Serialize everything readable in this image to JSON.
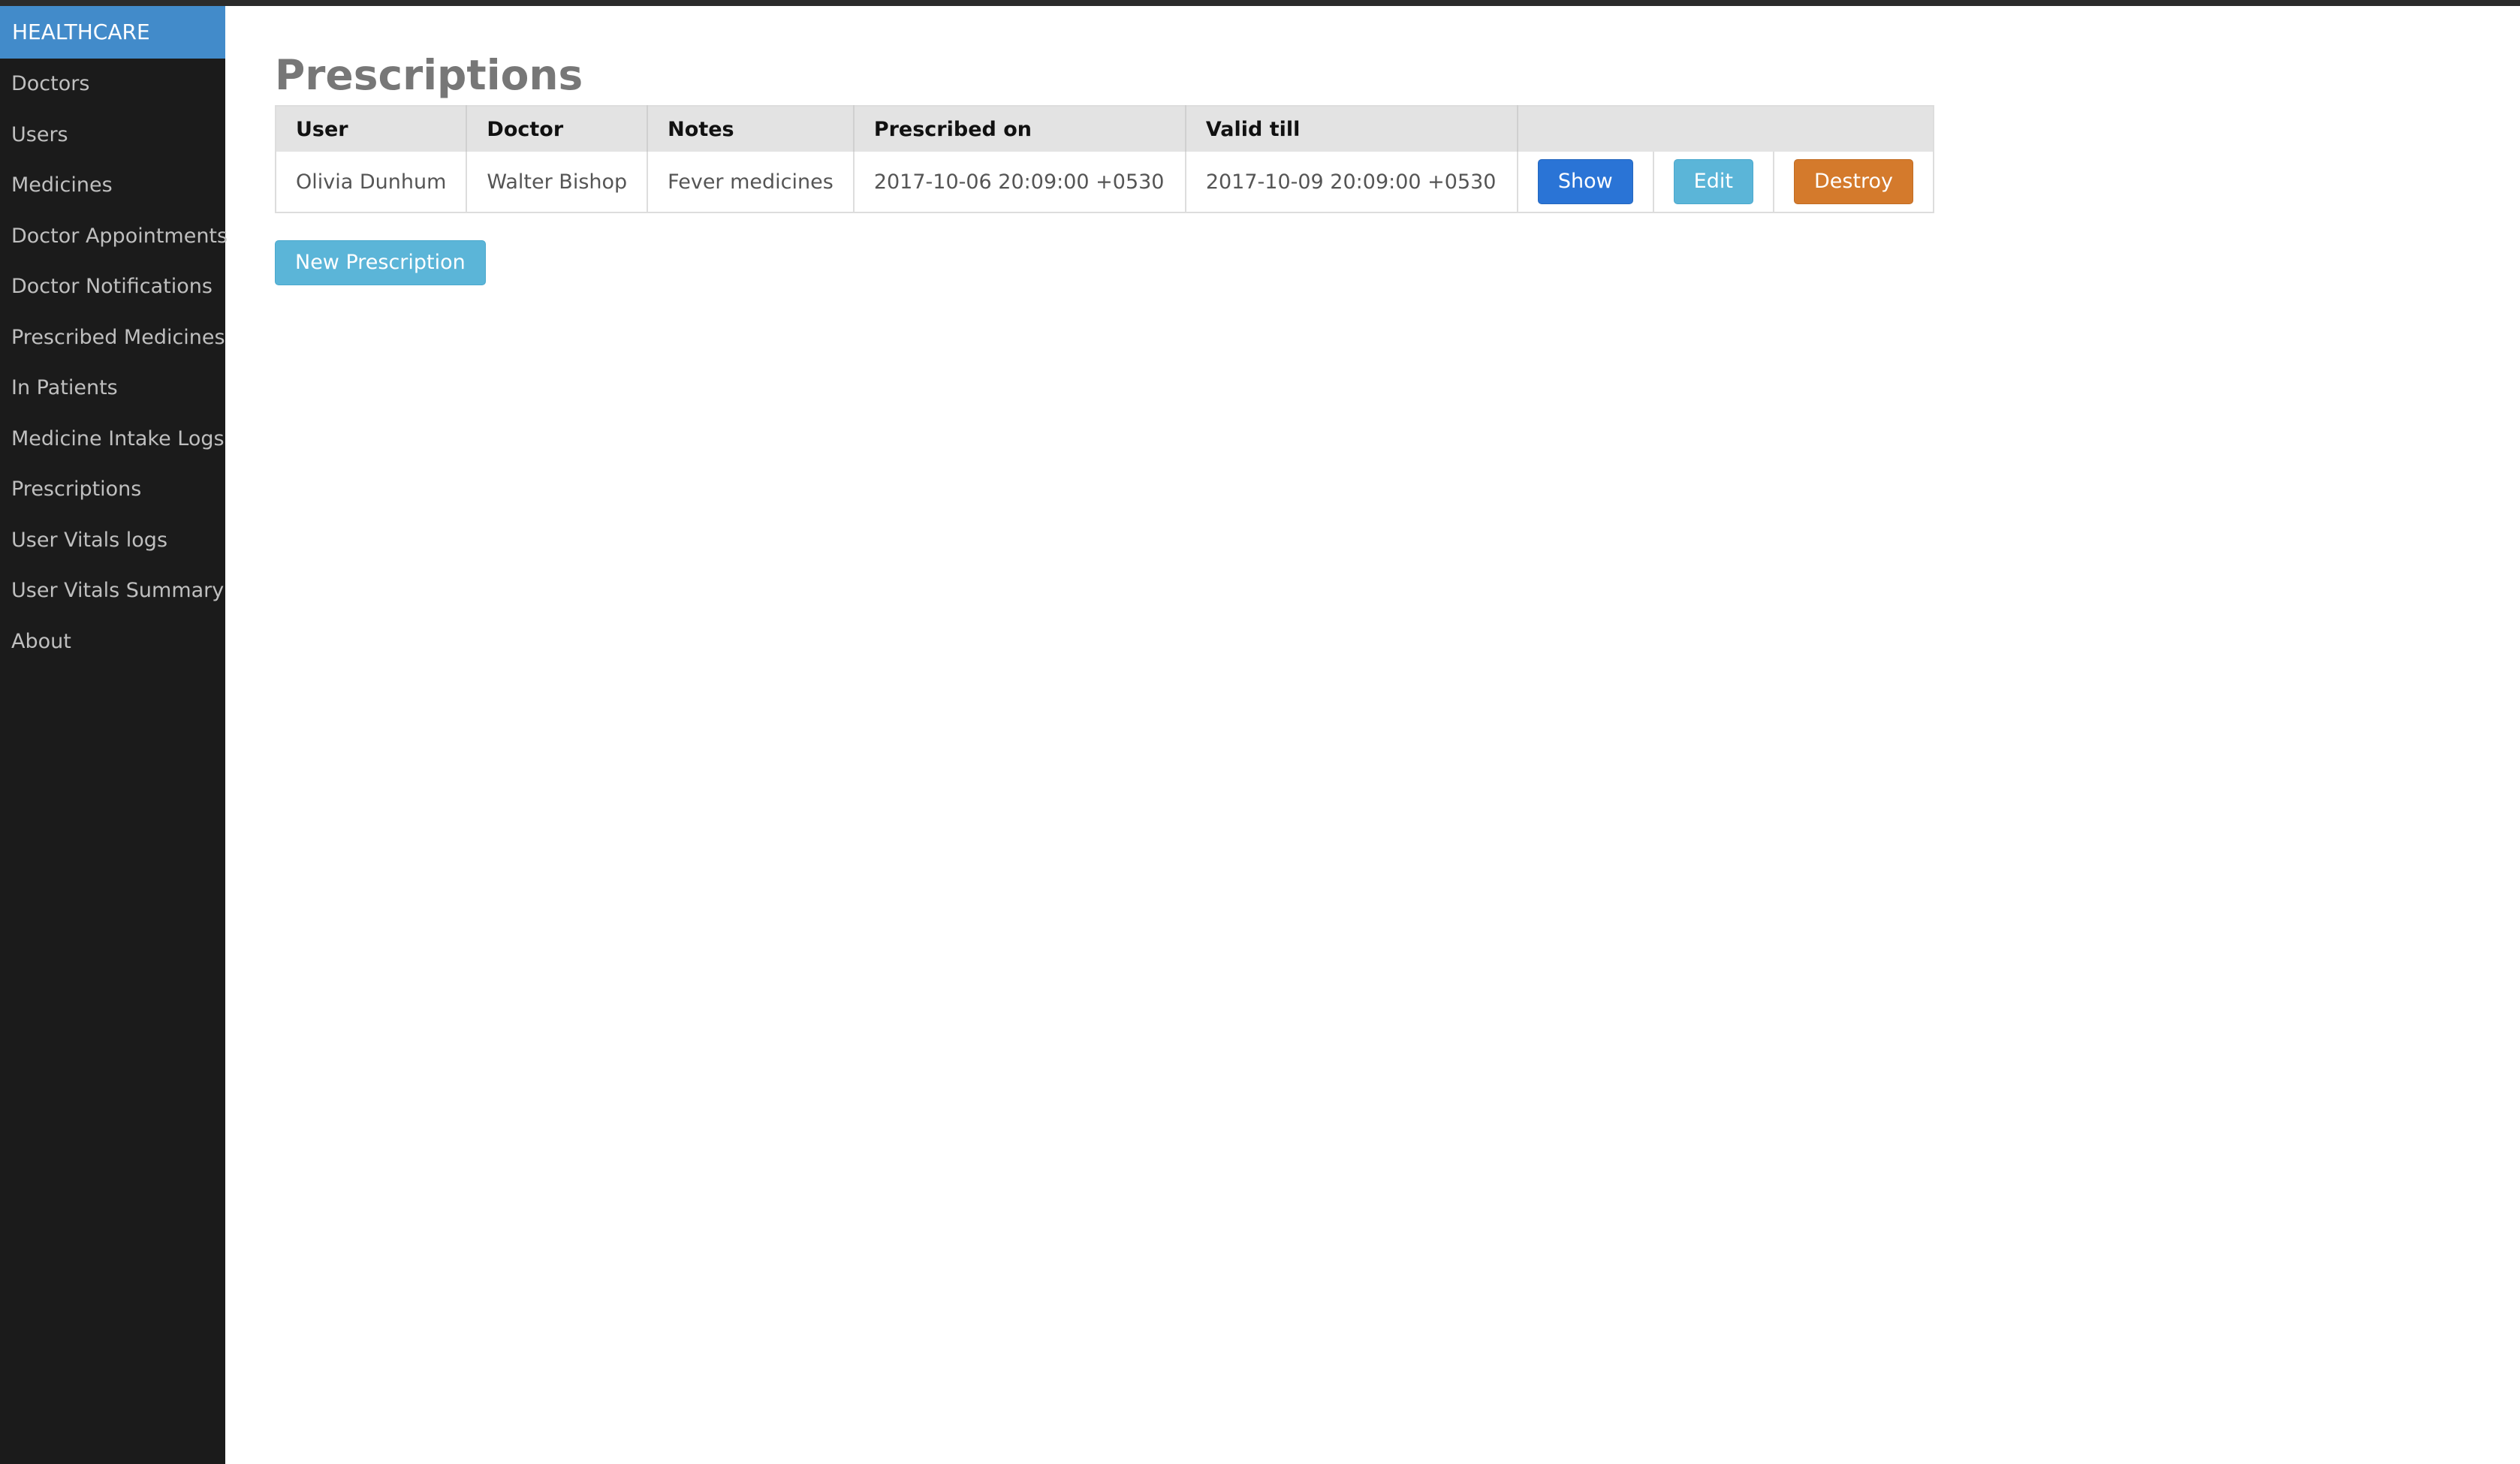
{
  "brand": "HEALTHCARE",
  "nav": [
    {
      "label": "Doctors"
    },
    {
      "label": "Users"
    },
    {
      "label": "Medicines"
    },
    {
      "label": "Doctor Appointments"
    },
    {
      "label": "Doctor Notifications"
    },
    {
      "label": "Prescribed Medicines"
    },
    {
      "label": "In Patients"
    },
    {
      "label": "Medicine Intake Logs"
    },
    {
      "label": "Prescriptions"
    },
    {
      "label": "User Vitals logs"
    },
    {
      "label": "User Vitals Summary"
    },
    {
      "label": "About"
    }
  ],
  "page": {
    "title": "Prescriptions"
  },
  "table": {
    "headers": [
      "User",
      "Doctor",
      "Notes",
      "Prescribed on",
      "Valid till",
      ""
    ],
    "rows": [
      {
        "user": "Olivia Dunhum",
        "doctor": "Walter Bishop",
        "notes": "Fever medicines",
        "prescribed_on": "2017-10-06 20:09:00 +0530",
        "valid_till": "2017-10-09 20:09:00 +0530",
        "show": "Show",
        "edit": "Edit",
        "destroy": "Destroy"
      }
    ]
  },
  "new_button": "New Prescription",
  "colors": {
    "brand": "#428bca",
    "sidebar": "#1b1b1b",
    "show": "#2a74d6",
    "edit": "#5bb5d8",
    "destroy": "#d47a2c"
  }
}
